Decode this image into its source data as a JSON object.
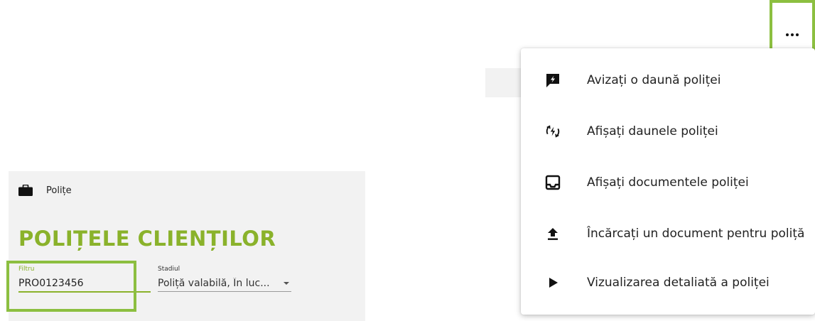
{
  "left_panel": {
    "breadcrumb": {
      "icon": "briefcase-icon",
      "label": "Polițe"
    },
    "title": "POLIȚELE CLIENȚILOR",
    "filter": {
      "label": "Filtru",
      "value": "PRO0123456"
    },
    "stage": {
      "label": "Stadiul",
      "value": "Poliță valabilă, În luc..."
    }
  },
  "more_button": {
    "icon": "more-horizontal-icon"
  },
  "menu": {
    "items": [
      {
        "icon": "report-claim-icon",
        "label": "Avizați o daună poliței"
      },
      {
        "icon": "claims-history-icon",
        "label": "Afișați daunele poliței"
      },
      {
        "icon": "inbox-document-icon",
        "label": "Afișați documentele poliței"
      },
      {
        "icon": "upload-icon",
        "label": "Încărcați un document pentru poliță"
      },
      {
        "icon": "play-arrow-icon",
        "label": "Vizualizarea detaliată a poliței"
      }
    ]
  },
  "colors": {
    "accent": "#8ab22b",
    "highlight": "#8cbf40",
    "panel_bg": "#f2f2f2"
  }
}
